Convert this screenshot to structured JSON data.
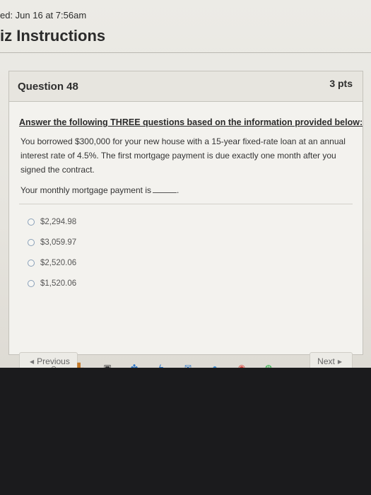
{
  "header": {
    "due_line": "ed: Jun 16 at 7:56am",
    "title": "iz Instructions"
  },
  "question": {
    "title": "Question 48",
    "points": "3 pts",
    "lead": "Answer the following THREE questions based on the information provided below:",
    "problem": "You borrowed $300,000 for your new house with a 15-year fixed-rate loan at an annual interest rate of 4.5%. The first mortgage payment is due exactly one month after you signed the contract.",
    "prompt": "Your monthly mortgage payment is",
    "prompt_end": ".",
    "answers": [
      {
        "label": "$2,294.98"
      },
      {
        "label": "$3,059.97"
      },
      {
        "label": "$2,520.06"
      },
      {
        "label": "$1,520.06"
      }
    ]
  },
  "nav": {
    "previous": "Previous",
    "next": "Next"
  },
  "taskbar_icons": [
    "record-icon",
    "document-icon",
    "briefcase-icon",
    "dropbox-icon",
    "bolt-icon",
    "mail-icon",
    "globe-icon",
    "chrome-icon",
    "spotify-icon"
  ]
}
